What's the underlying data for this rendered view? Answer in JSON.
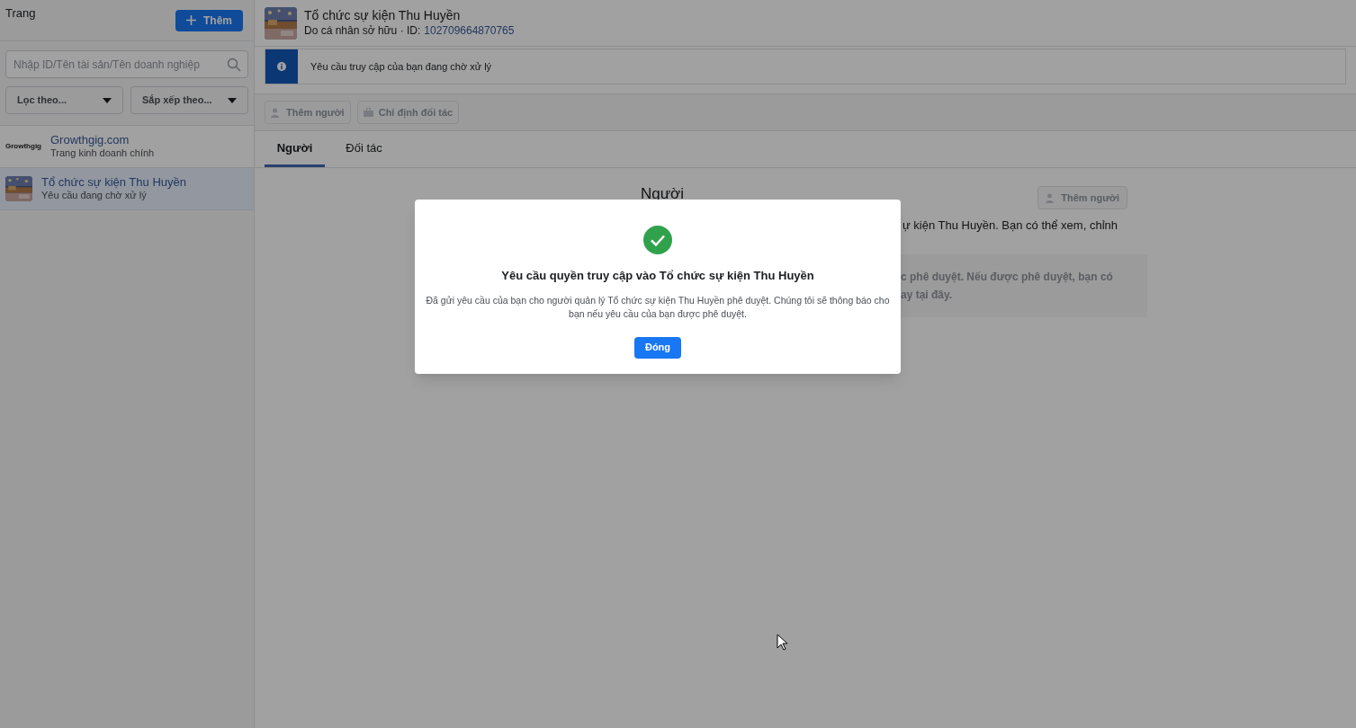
{
  "sidebar": {
    "title": "Trang",
    "add_button": "Thêm",
    "search": {
      "placeholder": "Nhập ID/Tên tài sản/Tên doanh nghiệp"
    },
    "filters": [
      "Lọc theo...",
      "Sắp xếp theo..."
    ],
    "items": [
      {
        "logo_text": "Growthgig",
        "kind": "logo",
        "name": "Growthgig.com",
        "subtitle": "Trang kinh doanh chính",
        "selected": false
      },
      {
        "kind": "picture",
        "name": "Tổ chức sự kiện Thu Huyền",
        "subtitle": "Yêu cầu đang chờ xử lý",
        "selected": true
      }
    ]
  },
  "page": {
    "title": "Tổ chức sự kiện Thu Huyền",
    "owner": "Do cá nhân sở hữu · ID:",
    "id": "102709664870765",
    "banner": "Yêu cầu truy cập của bạn đang chờ xử lý",
    "toolbar": [
      {
        "label": "Thêm người",
        "kind": "person",
        "disabled": true
      },
      {
        "label": "Chỉ định đối tác",
        "kind": "briefcase",
        "disabled": true
      }
    ],
    "tabs": [
      {
        "label": "Người",
        "selected": true
      },
      {
        "label": "Đối tác",
        "selected": false
      }
    ],
    "section_title": "Người",
    "section_button": "Thêm người",
    "description_fragment": "ự kiện Thu Huyền. Bạn có thể xem, chỉnh",
    "notice_fragments": [
      "c phê duyệt. Nếu được phê duyệt, bạn có",
      "ay tại đây."
    ]
  },
  "dialog": {
    "title": "Yêu cầu quyền truy cập vào Tổ chức sự kiện Thu Huyền",
    "message": "Đã gửi yêu cầu của bạn cho người quản lý Tổ chức sự kiện Thu Huyền phê duyệt. Chúng tôi sẽ thông báo cho bạn nếu yêu cầu của bạn được phê duyệt.",
    "button": "Đóng"
  }
}
